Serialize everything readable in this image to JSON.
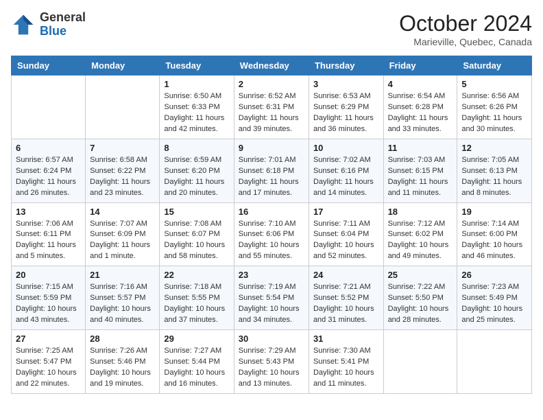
{
  "header": {
    "logo_general": "General",
    "logo_blue": "Blue",
    "month_title": "October 2024",
    "location": "Marieville, Quebec, Canada"
  },
  "weekdays": [
    "Sunday",
    "Monday",
    "Tuesday",
    "Wednesday",
    "Thursday",
    "Friday",
    "Saturday"
  ],
  "weeks": [
    [
      {
        "day": "",
        "sunrise": "",
        "sunset": "",
        "daylight": ""
      },
      {
        "day": "",
        "sunrise": "",
        "sunset": "",
        "daylight": ""
      },
      {
        "day": "1",
        "sunrise": "Sunrise: 6:50 AM",
        "sunset": "Sunset: 6:33 PM",
        "daylight": "Daylight: 11 hours and 42 minutes."
      },
      {
        "day": "2",
        "sunrise": "Sunrise: 6:52 AM",
        "sunset": "Sunset: 6:31 PM",
        "daylight": "Daylight: 11 hours and 39 minutes."
      },
      {
        "day": "3",
        "sunrise": "Sunrise: 6:53 AM",
        "sunset": "Sunset: 6:29 PM",
        "daylight": "Daylight: 11 hours and 36 minutes."
      },
      {
        "day": "4",
        "sunrise": "Sunrise: 6:54 AM",
        "sunset": "Sunset: 6:28 PM",
        "daylight": "Daylight: 11 hours and 33 minutes."
      },
      {
        "day": "5",
        "sunrise": "Sunrise: 6:56 AM",
        "sunset": "Sunset: 6:26 PM",
        "daylight": "Daylight: 11 hours and 30 minutes."
      }
    ],
    [
      {
        "day": "6",
        "sunrise": "Sunrise: 6:57 AM",
        "sunset": "Sunset: 6:24 PM",
        "daylight": "Daylight: 11 hours and 26 minutes."
      },
      {
        "day": "7",
        "sunrise": "Sunrise: 6:58 AM",
        "sunset": "Sunset: 6:22 PM",
        "daylight": "Daylight: 11 hours and 23 minutes."
      },
      {
        "day": "8",
        "sunrise": "Sunrise: 6:59 AM",
        "sunset": "Sunset: 6:20 PM",
        "daylight": "Daylight: 11 hours and 20 minutes."
      },
      {
        "day": "9",
        "sunrise": "Sunrise: 7:01 AM",
        "sunset": "Sunset: 6:18 PM",
        "daylight": "Daylight: 11 hours and 17 minutes."
      },
      {
        "day": "10",
        "sunrise": "Sunrise: 7:02 AM",
        "sunset": "Sunset: 6:16 PM",
        "daylight": "Daylight: 11 hours and 14 minutes."
      },
      {
        "day": "11",
        "sunrise": "Sunrise: 7:03 AM",
        "sunset": "Sunset: 6:15 PM",
        "daylight": "Daylight: 11 hours and 11 minutes."
      },
      {
        "day": "12",
        "sunrise": "Sunrise: 7:05 AM",
        "sunset": "Sunset: 6:13 PM",
        "daylight": "Daylight: 11 hours and 8 minutes."
      }
    ],
    [
      {
        "day": "13",
        "sunrise": "Sunrise: 7:06 AM",
        "sunset": "Sunset: 6:11 PM",
        "daylight": "Daylight: 11 hours and 5 minutes."
      },
      {
        "day": "14",
        "sunrise": "Sunrise: 7:07 AM",
        "sunset": "Sunset: 6:09 PM",
        "daylight": "Daylight: 11 hours and 1 minute."
      },
      {
        "day": "15",
        "sunrise": "Sunrise: 7:08 AM",
        "sunset": "Sunset: 6:07 PM",
        "daylight": "Daylight: 10 hours and 58 minutes."
      },
      {
        "day": "16",
        "sunrise": "Sunrise: 7:10 AM",
        "sunset": "Sunset: 6:06 PM",
        "daylight": "Daylight: 10 hours and 55 minutes."
      },
      {
        "day": "17",
        "sunrise": "Sunrise: 7:11 AM",
        "sunset": "Sunset: 6:04 PM",
        "daylight": "Daylight: 10 hours and 52 minutes."
      },
      {
        "day": "18",
        "sunrise": "Sunrise: 7:12 AM",
        "sunset": "Sunset: 6:02 PM",
        "daylight": "Daylight: 10 hours and 49 minutes."
      },
      {
        "day": "19",
        "sunrise": "Sunrise: 7:14 AM",
        "sunset": "Sunset: 6:00 PM",
        "daylight": "Daylight: 10 hours and 46 minutes."
      }
    ],
    [
      {
        "day": "20",
        "sunrise": "Sunrise: 7:15 AM",
        "sunset": "Sunset: 5:59 PM",
        "daylight": "Daylight: 10 hours and 43 minutes."
      },
      {
        "day": "21",
        "sunrise": "Sunrise: 7:16 AM",
        "sunset": "Sunset: 5:57 PM",
        "daylight": "Daylight: 10 hours and 40 minutes."
      },
      {
        "day": "22",
        "sunrise": "Sunrise: 7:18 AM",
        "sunset": "Sunset: 5:55 PM",
        "daylight": "Daylight: 10 hours and 37 minutes."
      },
      {
        "day": "23",
        "sunrise": "Sunrise: 7:19 AM",
        "sunset": "Sunset: 5:54 PM",
        "daylight": "Daylight: 10 hours and 34 minutes."
      },
      {
        "day": "24",
        "sunrise": "Sunrise: 7:21 AM",
        "sunset": "Sunset: 5:52 PM",
        "daylight": "Daylight: 10 hours and 31 minutes."
      },
      {
        "day": "25",
        "sunrise": "Sunrise: 7:22 AM",
        "sunset": "Sunset: 5:50 PM",
        "daylight": "Daylight: 10 hours and 28 minutes."
      },
      {
        "day": "26",
        "sunrise": "Sunrise: 7:23 AM",
        "sunset": "Sunset: 5:49 PM",
        "daylight": "Daylight: 10 hours and 25 minutes."
      }
    ],
    [
      {
        "day": "27",
        "sunrise": "Sunrise: 7:25 AM",
        "sunset": "Sunset: 5:47 PM",
        "daylight": "Daylight: 10 hours and 22 minutes."
      },
      {
        "day": "28",
        "sunrise": "Sunrise: 7:26 AM",
        "sunset": "Sunset: 5:46 PM",
        "daylight": "Daylight: 10 hours and 19 minutes."
      },
      {
        "day": "29",
        "sunrise": "Sunrise: 7:27 AM",
        "sunset": "Sunset: 5:44 PM",
        "daylight": "Daylight: 10 hours and 16 minutes."
      },
      {
        "day": "30",
        "sunrise": "Sunrise: 7:29 AM",
        "sunset": "Sunset: 5:43 PM",
        "daylight": "Daylight: 10 hours and 13 minutes."
      },
      {
        "day": "31",
        "sunrise": "Sunrise: 7:30 AM",
        "sunset": "Sunset: 5:41 PM",
        "daylight": "Daylight: 10 hours and 11 minutes."
      },
      {
        "day": "",
        "sunrise": "",
        "sunset": "",
        "daylight": ""
      },
      {
        "day": "",
        "sunrise": "",
        "sunset": "",
        "daylight": ""
      }
    ]
  ]
}
